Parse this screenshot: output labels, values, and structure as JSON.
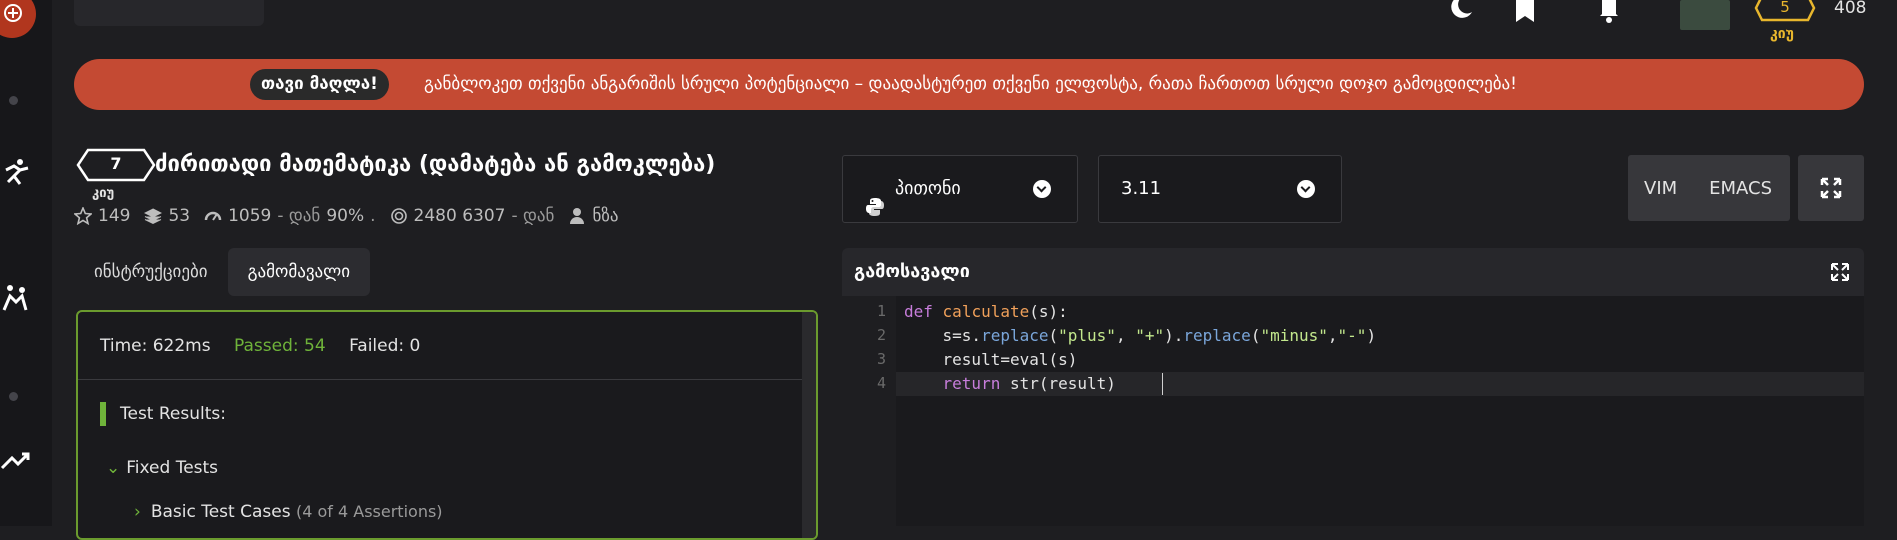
{
  "user": {
    "rank_value": "5",
    "rank_label": "კიუ",
    "honor": "408"
  },
  "banner": {
    "pill": "თავი მაღლა!",
    "message": "განბლოკეთ თქვენი ანგარიშის სრული პოტენციალი – დაადასტურეთ თქვენი ელფოსტა, რათა ჩართოთ სრული დოჯო გამოცდილება!"
  },
  "kata": {
    "kyu_number": "7",
    "kyu_label": "კიუ",
    "title": "ძირითადი მათემატიკა (დამატება ან გამოკლება)",
    "stats": {
      "stars": "149",
      "collections": "53",
      "completed": "1059",
      "completed_suffix": "- დან",
      "satisfaction": "90%",
      "satisfaction_suffix": ".",
      "attempts": "2480 6307",
      "attempts_suffix": "- დან",
      "author": "ნზა"
    }
  },
  "tabs": [
    {
      "label": "ინსტრუქციები"
    },
    {
      "label": "გამომავალი"
    }
  ],
  "results": {
    "time": "Time: 622ms",
    "passed": "Passed: 54",
    "failed": "Failed: 0",
    "heading": "Test Results:",
    "group": "Fixed Tests",
    "subgroup": "Basic Test Cases",
    "subgroup_note": "(4 of 4 Assertions)"
  },
  "language": {
    "label": "პითონი"
  },
  "version": {
    "label": "3.11"
  },
  "keybindings": [
    "VIM",
    "EMACS"
  ],
  "editor": {
    "title": "გამოსავალი",
    "line_numbers": [
      "1",
      "2",
      "3",
      "4"
    ]
  },
  "colors": {
    "banner": "#c44a33",
    "passed": "#6fb33a",
    "rank": "#e8b62d"
  }
}
